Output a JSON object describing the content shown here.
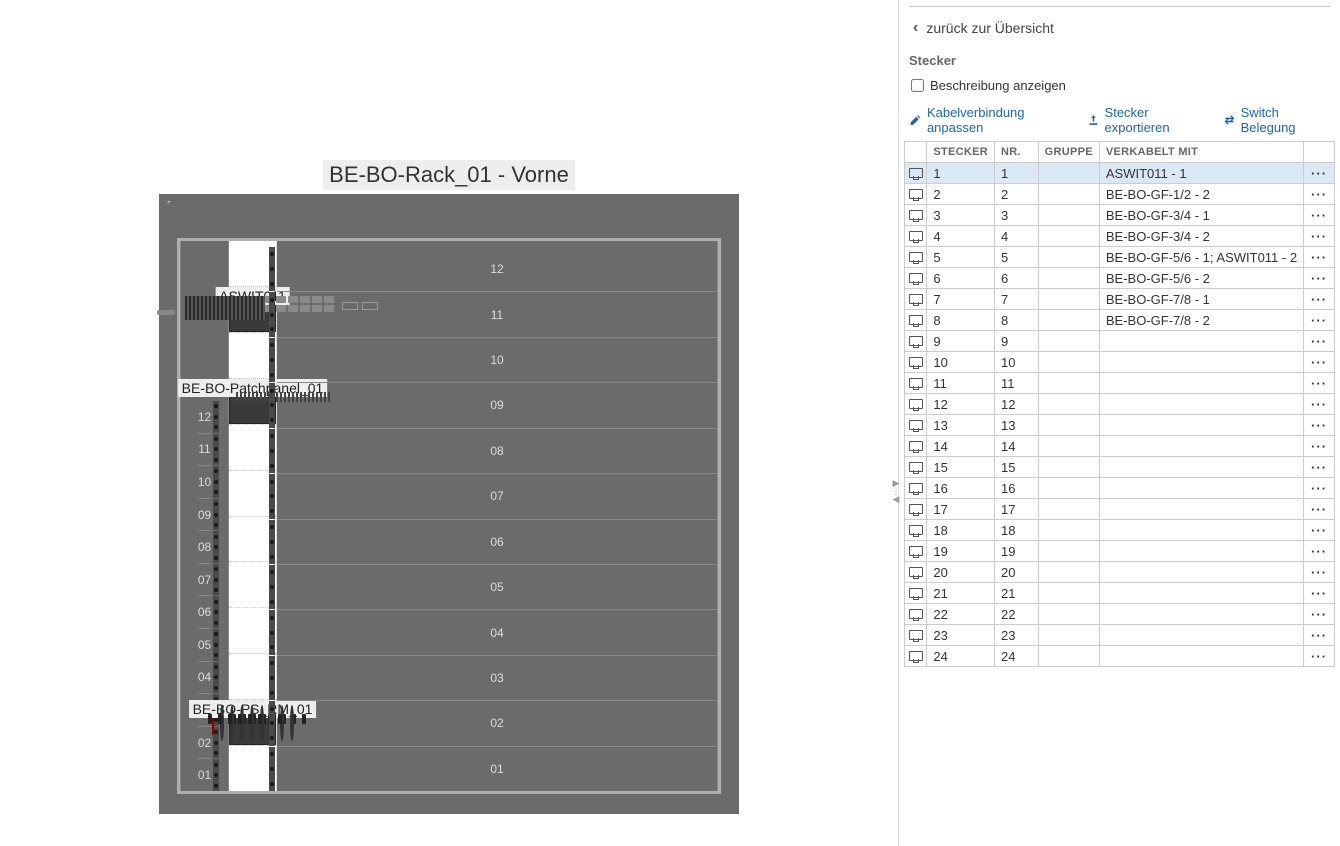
{
  "rack": {
    "title": "BE-BO-Rack_01 - Vorne",
    "units": [
      "12",
      "11",
      "10",
      "09",
      "08",
      "07",
      "06",
      "05",
      "04",
      "03",
      "02",
      "01"
    ],
    "devices": {
      "switch": {
        "label": "ASWIT011",
        "slot_index": 1
      },
      "patch": {
        "label": "BE-BO-Patchpanel_01",
        "slot_index": 3
      },
      "pdu": {
        "label": "BE-BO-PS_RM_01",
        "slot_index": 10
      }
    }
  },
  "panel": {
    "back_label": "zurück zur Übersicht",
    "section_title": "Stecker",
    "checkbox_label": "Beschreibung anzeigen",
    "checkbox_checked": false,
    "actions": {
      "edit": "Kabelverbindung anpassen",
      "export": "Stecker exportieren",
      "layout": "Switch Belegung"
    },
    "columns": {
      "icon": "",
      "stecker": "STECKER",
      "nr": "NR.",
      "gruppe": "GRUPPE",
      "verkabelt": "VERKABELT MIT",
      "menu": ""
    },
    "rows": [
      {
        "stecker": "1",
        "nr": "1",
        "gruppe": "",
        "verkabelt": "ASWIT011 - 1",
        "selected": true
      },
      {
        "stecker": "2",
        "nr": "2",
        "gruppe": "",
        "verkabelt": "BE-BO-GF-1/2 - 2"
      },
      {
        "stecker": "3",
        "nr": "3",
        "gruppe": "",
        "verkabelt": "BE-BO-GF-3/4 - 1"
      },
      {
        "stecker": "4",
        "nr": "4",
        "gruppe": "",
        "verkabelt": "BE-BO-GF-3/4 - 2"
      },
      {
        "stecker": "5",
        "nr": "5",
        "gruppe": "",
        "verkabelt": "BE-BO-GF-5/6 - 1; ASWIT011 - 2"
      },
      {
        "stecker": "6",
        "nr": "6",
        "gruppe": "",
        "verkabelt": "BE-BO-GF-5/6 - 2"
      },
      {
        "stecker": "7",
        "nr": "7",
        "gruppe": "",
        "verkabelt": "BE-BO-GF-7/8 - 1"
      },
      {
        "stecker": "8",
        "nr": "8",
        "gruppe": "",
        "verkabelt": "BE-BO-GF-7/8 - 2"
      },
      {
        "stecker": "9",
        "nr": "9",
        "gruppe": "",
        "verkabelt": ""
      },
      {
        "stecker": "10",
        "nr": "10",
        "gruppe": "",
        "verkabelt": ""
      },
      {
        "stecker": "11",
        "nr": "11",
        "gruppe": "",
        "verkabelt": ""
      },
      {
        "stecker": "12",
        "nr": "12",
        "gruppe": "",
        "verkabelt": ""
      },
      {
        "stecker": "13",
        "nr": "13",
        "gruppe": "",
        "verkabelt": ""
      },
      {
        "stecker": "14",
        "nr": "14",
        "gruppe": "",
        "verkabelt": ""
      },
      {
        "stecker": "15",
        "nr": "15",
        "gruppe": "",
        "verkabelt": ""
      },
      {
        "stecker": "16",
        "nr": "16",
        "gruppe": "",
        "verkabelt": ""
      },
      {
        "stecker": "17",
        "nr": "17",
        "gruppe": "",
        "verkabelt": ""
      },
      {
        "stecker": "18",
        "nr": "18",
        "gruppe": "",
        "verkabelt": ""
      },
      {
        "stecker": "19",
        "nr": "19",
        "gruppe": "",
        "verkabelt": ""
      },
      {
        "stecker": "20",
        "nr": "20",
        "gruppe": "",
        "verkabelt": ""
      },
      {
        "stecker": "21",
        "nr": "21",
        "gruppe": "",
        "verkabelt": ""
      },
      {
        "stecker": "22",
        "nr": "22",
        "gruppe": "",
        "verkabelt": ""
      },
      {
        "stecker": "23",
        "nr": "23",
        "gruppe": "",
        "verkabelt": ""
      },
      {
        "stecker": "24",
        "nr": "24",
        "gruppe": "",
        "verkabelt": ""
      }
    ]
  }
}
